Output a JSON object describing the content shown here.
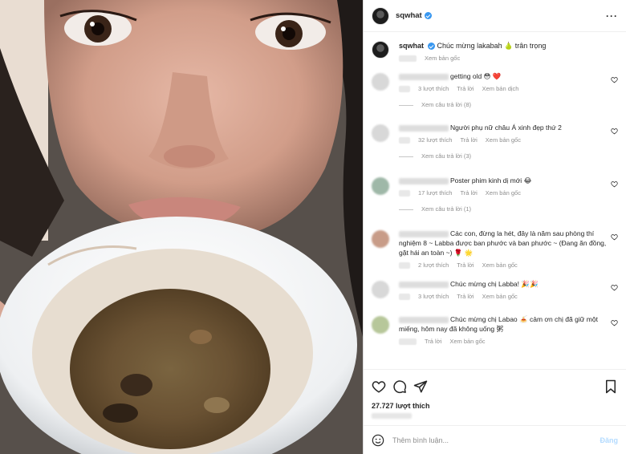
{
  "post": {
    "username": "sqwhat",
    "verified": true,
    "caption_text": "Chúc mừng lakabah 🍐 trân trọng",
    "caption_translate": "Xem bản gốc"
  },
  "comments": [
    {
      "text": "getting old 😳 ❤️",
      "likes": "3 lượt thích",
      "reply": "Trả lời",
      "translate": "Xem bản dịch",
      "view_replies": "Xem câu trả lời (8)"
    },
    {
      "text": "Người phụ nữ châu Á xinh đẹp thứ 2",
      "likes": "32 lượt thích",
      "reply": "Trả lời",
      "translate": "Xem bản gốc",
      "view_replies": "Xem câu trả lời (3)"
    },
    {
      "text": "Poster phim kinh dị mới 😂",
      "likes": "17 lượt thích",
      "reply": "Trả lời",
      "translate": "Xem bản gốc",
      "view_replies": "Xem câu trả lời (1)"
    },
    {
      "text": "Các con, đừng la hét, đây là năm sau phòng thí nghiệm 8 ~ Labba được ban phước và ban phước ~ (Đang ăn đồng, gặt hái an toàn ~) 🌹 🌟",
      "likes": "2 lượt thích",
      "reply": "Trả lời",
      "translate": "Xem bản gốc",
      "view_replies": ""
    },
    {
      "text": "Chúc mừng chị Labba! 🎉🎉",
      "likes": "3 lượt thích",
      "reply": "Trả lời",
      "translate": "Xem bản gốc",
      "view_replies": ""
    },
    {
      "text": "Chúc mừng chị Labao 🍝 cảm ơn chị đã giữ một miếng, hôm nay đã không uống 粥",
      "likes": "",
      "reply": "Trả lời",
      "translate": "Xem bản gốc",
      "view_replies": ""
    }
  ],
  "actions": {
    "likes_count": "27.727 lượt thích"
  },
  "comment_box": {
    "placeholder": "Thêm bình luận...",
    "post_label": "Đăng"
  },
  "colors": {
    "accent": "#3897f0",
    "like_red": "#ed4956",
    "muted": "#8e8e8e"
  },
  "icons": [
    "more-icon",
    "verified-badge",
    "heart-icon",
    "comment-icon",
    "share-icon",
    "save-icon",
    "emoji-icon"
  ]
}
